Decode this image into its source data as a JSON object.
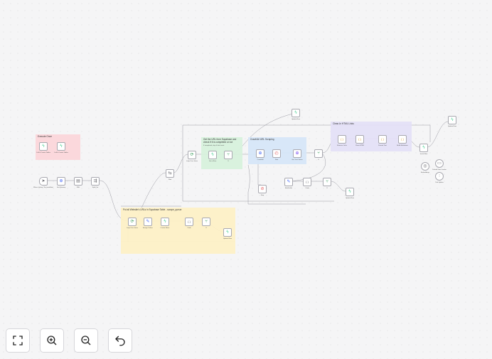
{
  "stickies": [
    {
      "id": "execute-once",
      "title": "Execute Once",
      "subtitle": "",
      "color": "#fbd8dc"
    },
    {
      "id": "put-urls",
      "title": "Put all Website's URLs in Supabase Table - scrape_queue",
      "subtitle": "",
      "color": "#fdf0c6"
    },
    {
      "id": "get-url",
      "title": "Get the URL from Supabase and check if it is completed or not",
      "subtitle": "If completed, skip & fetch next",
      "color": "#d7f1dc"
    },
    {
      "id": "crawl4ai",
      "title": "Crawl4AI URL Scraping",
      "subtitle": "",
      "color": "#d6e6f8"
    },
    {
      "id": "clean-html",
      "title": "Clean-In HTML Links",
      "subtitle": "",
      "color": "#e4e0f7"
    }
  ],
  "nodes": [
    {
      "id": "exec-a",
      "icon": "supabase-icon",
      "label": "Call & Create Tables",
      "color": "#3ecf8e"
    },
    {
      "id": "exec-b",
      "icon": "supabase-icon",
      "label": "Call & Create Tables",
      "color": "#3ecf8e"
    },
    {
      "id": "trigger",
      "icon": "cursor-icon",
      "label": "When clicking 'Test workflow'",
      "color": "#6a6a70"
    },
    {
      "id": "sitemap",
      "icon": "http-icon",
      "label": "Get Sitemap",
      "color": "#4a6cf7"
    },
    {
      "id": "xml",
      "icon": "xml-icon",
      "label": "XML",
      "color": "#6a6a70"
    },
    {
      "id": "split",
      "icon": "split-icon",
      "label": "Split Out",
      "color": "#6a6a70"
    },
    {
      "id": "loop1",
      "icon": "loop-icon",
      "label": "Loop Over Items",
      "color": "#3a9d5d"
    },
    {
      "id": "edit1",
      "icon": "pencil-icon",
      "label": "Assign Values",
      "color": "#4a6cf7"
    },
    {
      "id": "sb-create",
      "icon": "supabase-icon",
      "label": "Create Rows",
      "color": "#3ecf8e"
    },
    {
      "id": "code1",
      "icon": "code-icon",
      "label": "Code",
      "color": "#6a6a70"
    },
    {
      "id": "if1",
      "icon": "if-icon",
      "label": "If",
      "color": "#3a9d5d"
    },
    {
      "id": "sb-row2",
      "icon": "supabase-icon",
      "label": "Update Row",
      "color": "#3ecf8e"
    },
    {
      "id": "merge1",
      "icon": "merge-icon",
      "label": "Wait",
      "color": "#6a6a70"
    },
    {
      "id": "loop2",
      "icon": "loop-icon",
      "label": "Loop Over Items",
      "color": "#3a9d5d"
    },
    {
      "id": "sb-get",
      "icon": "supabase-icon",
      "label": "Get a Row",
      "color": "#3ecf8e"
    },
    {
      "id": "if2",
      "icon": "if-icon",
      "label": "If",
      "color": "#3a9d5d"
    },
    {
      "id": "crawl-run",
      "icon": "http-icon",
      "label": "Crawl4AI",
      "color": "#4a6cf7"
    },
    {
      "id": "wait2",
      "icon": "wait-icon",
      "label": "Wait",
      "color": "#e35d5d"
    },
    {
      "id": "crawl-task",
      "icon": "http-icon",
      "label": "Get Task Status",
      "color": "#7a4cf0"
    },
    {
      "id": "if3",
      "icon": "if-icon",
      "label": "If",
      "color": "#3a9d5d"
    },
    {
      "id": "stop",
      "icon": "stop-icon",
      "label": "Stop",
      "color": "#e35d5d"
    },
    {
      "id": "sb-top",
      "icon": "supabase-icon",
      "label": "Update Row",
      "color": "#3ecf8e"
    },
    {
      "id": "clean1",
      "icon": "code-icon",
      "label": "Remove Links",
      "color": "#e0a02e"
    },
    {
      "id": "clean2",
      "icon": "code-icon",
      "label": "Clean HTML",
      "color": "#e0a02e"
    },
    {
      "id": "clean3",
      "icon": "code-icon",
      "label": "Format Text",
      "color": "#e0a02e"
    },
    {
      "id": "clean4",
      "icon": "code-icon",
      "label": "Build Markdown",
      "color": "#e0a02e"
    },
    {
      "id": "sb-clean",
      "icon": "supabase-icon",
      "label": "Insert Row",
      "color": "#3ecf8e"
    },
    {
      "id": "sb-far",
      "icon": "supabase-icon",
      "label": "Update Row",
      "color": "#3ecf8e"
    },
    {
      "id": "embed",
      "icon": "embed-icon",
      "label": "Embeddings",
      "color": "#6a6a70"
    },
    {
      "id": "loader",
      "icon": "doc-icon",
      "label": "Default Data Loader",
      "color": "#6a6a70"
    },
    {
      "id": "splitter",
      "icon": "splitter-icon",
      "label": "Text Splitter",
      "color": "#6a6a70"
    },
    {
      "id": "edit2",
      "icon": "pencil-icon",
      "label": "Edit Fields",
      "color": "#4a6cf7"
    },
    {
      "id": "code2",
      "icon": "code-icon",
      "label": "Code",
      "color": "#6a6a70"
    },
    {
      "id": "if4",
      "icon": "if-icon",
      "label": "If",
      "color": "#3a9d5d"
    },
    {
      "id": "sb-bottom",
      "icon": "supabase-icon",
      "label": "Update Row",
      "color": "#3ecf8e"
    }
  ],
  "controls": [
    {
      "id": "fit-view-button",
      "icon": "fit-view-icon"
    },
    {
      "id": "zoom-in-button",
      "icon": "zoom-in-icon"
    },
    {
      "id": "zoom-out-button",
      "icon": "zoom-out-icon"
    },
    {
      "id": "undo-button",
      "icon": "undo-icon"
    }
  ]
}
